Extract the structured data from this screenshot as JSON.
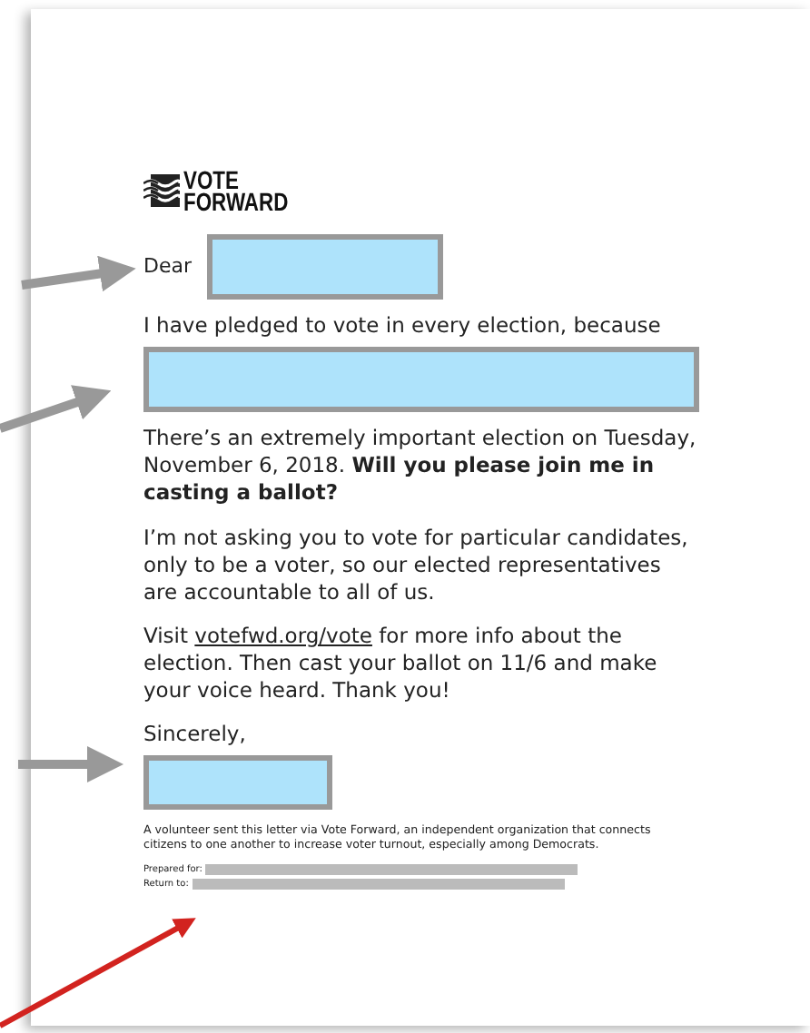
{
  "logo": {
    "lines": [
      "VOTE",
      "FORWARD"
    ]
  },
  "salutation": "Dear",
  "pledge": "I have pledged to vote in every election, because",
  "paragraphs": [
    "There’s an extremely important election on Tuesday, November 6, 2018. **Will you please join me in casting a ballot?**",
    "I’m not asking you to vote for particular candidates, only to be a voter, so our elected representatives are accountable to all of us."
  ],
  "visit": {
    "before": "Visit",
    "link": "votefwd.org/vote",
    "after": "for more info about the election. Then cast your ballot on 11/6 and make your voice heard. Thank you!"
  },
  "closing": "Sincerely,",
  "footnote": "A volunteer sent this letter via Vote Forward, an independent organization that connects citizens to one another to increase voter turnout, especially among Democrats.",
  "address_lines": [
    {
      "label": "Prepared for:"
    },
    {
      "label": "Return to:"
    }
  ]
}
